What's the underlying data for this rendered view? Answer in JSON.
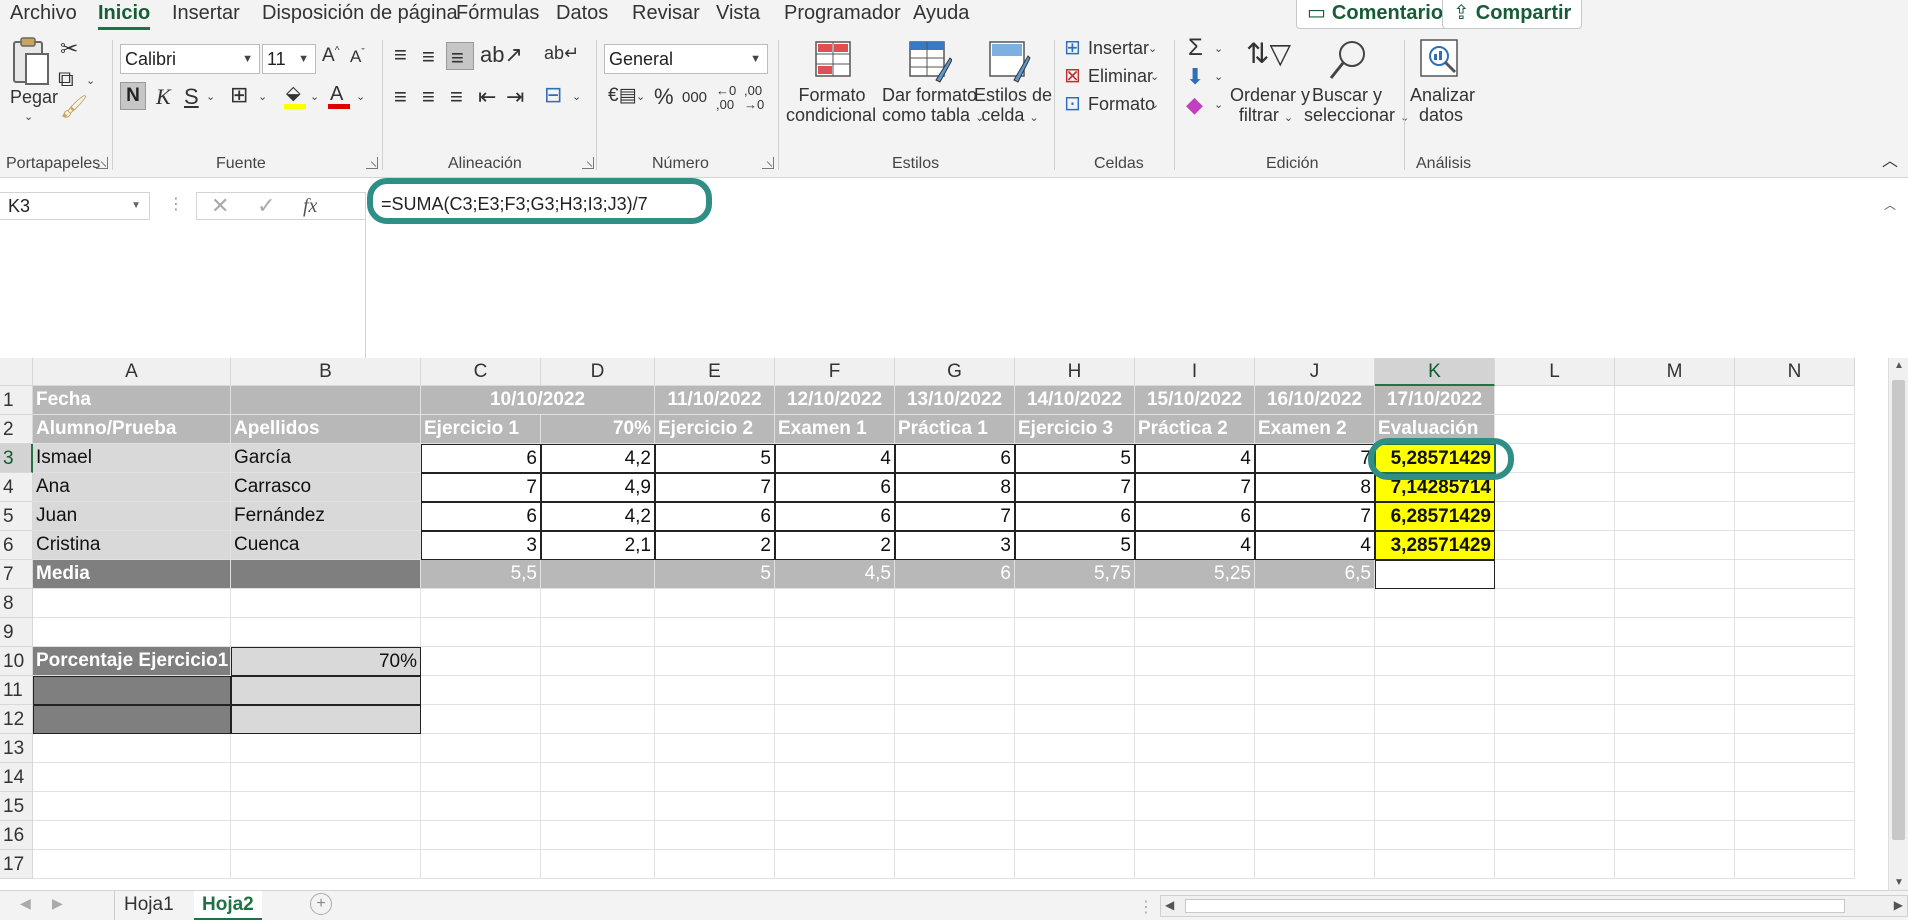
{
  "menu": {
    "items": [
      "Archivo",
      "Inicio",
      "Insertar",
      "Disposición de página",
      "Fórmulas",
      "Datos",
      "Revisar",
      "Vista",
      "Programador",
      "Ayuda"
    ],
    "active": "Inicio",
    "comments_label": "Comentarios",
    "share_label": "Compartir"
  },
  "ribbon": {
    "clipboard": {
      "paste_label": "Pegar",
      "group_label": "Portapapeles"
    },
    "font": {
      "font_name": "Calibri",
      "font_size": "11",
      "bold": "N",
      "italic": "K",
      "underline": "S",
      "group_label": "Fuente",
      "fill_color": "#ffff00",
      "font_color": "#e00000"
    },
    "alignment": {
      "group_label": "Alineación"
    },
    "number": {
      "format": "General",
      "percent": "%",
      "thousands": "000",
      "dec_inc": ",00",
      "dec_dec": ",00",
      "group_label": "Número"
    },
    "styles": {
      "conditional_l1": "Formato",
      "conditional_l2": "condicional",
      "table_l1": "Dar formato",
      "table_l2": "como tabla",
      "cell_styles_l1": "Estilos de",
      "cell_styles_l2": "celda",
      "group_label": "Estilos"
    },
    "cells": {
      "insert": "Insertar",
      "delete": "Eliminar",
      "format": "Formato",
      "group_label": "Celdas"
    },
    "editing": {
      "sort_l1": "Ordenar y",
      "sort_l2": "filtrar",
      "find_l1": "Buscar y",
      "find_l2": "seleccionar",
      "group_label": "Edición"
    },
    "analysis": {
      "analyze_l1": "Analizar",
      "analyze_l2": "datos",
      "group_label": "Análisis"
    }
  },
  "formula_bar": {
    "name_box": "K3",
    "fx": "fx",
    "formula": "=SUMA(C3;E3;F3;G3;H3;I3;J3)/7"
  },
  "grid": {
    "columns": [
      "A",
      "B",
      "C",
      "D",
      "E",
      "F",
      "G",
      "H",
      "I",
      "J",
      "K",
      "L",
      "M",
      "N"
    ],
    "selected_column": "K",
    "rows": [
      "1",
      "2",
      "3",
      "4",
      "5",
      "6",
      "7",
      "8",
      "9",
      "10",
      "11",
      "12",
      "13",
      "14",
      "15",
      "16",
      "17"
    ],
    "selected_row": "3",
    "header_row1": {
      "a": "Fecha",
      "cd": "10/10/2022",
      "e": "11/10/2022",
      "f": "12/10/2022",
      "g": "13/10/2022",
      "h": "14/10/2022",
      "i": "15/10/2022",
      "j": "16/10/2022",
      "k": "17/10/2022"
    },
    "header_row2": {
      "a": "Alumno/Prueba",
      "b": "Apellidos",
      "c": "Ejercicio 1",
      "d": "70%",
      "e": "Ejercicio 2",
      "f": "Examen 1",
      "g": "Práctica 1",
      "h": "Ejercicio 3",
      "i": "Práctica 2",
      "j": "Examen 2",
      "k": "Evaluación"
    },
    "students": [
      {
        "name": "Ismael",
        "surname": "García",
        "c": "6",
        "d": "4,2",
        "e": "5",
        "f": "4",
        "g": "6",
        "h": "5",
        "i": "4",
        "j": "7",
        "k": "5,28571429"
      },
      {
        "name": "Ana",
        "surname": "Carrasco",
        "c": "7",
        "d": "4,9",
        "e": "7",
        "f": "6",
        "g": "8",
        "h": "7",
        "i": "7",
        "j": "8",
        "k": "7,14285714"
      },
      {
        "name": "Juan",
        "surname": "Fernández",
        "c": "6",
        "d": "4,2",
        "e": "6",
        "f": "6",
        "g": "7",
        "h": "6",
        "i": "6",
        "j": "7",
        "k": "6,28571429"
      },
      {
        "name": "Cristina",
        "surname": "Cuenca",
        "c": "3",
        "d": "2,1",
        "e": "2",
        "f": "2",
        "g": "3",
        "h": "5",
        "i": "4",
        "j": "4",
        "k": "3,28571429"
      }
    ],
    "media_row": {
      "label": "Media",
      "c": "5,5",
      "e": "5",
      "f": "4,5",
      "g": "6",
      "h": "5,75",
      "i": "5,25",
      "j": "6,5"
    },
    "percent_row": {
      "label": "Porcentaje Ejercicio1",
      "value": "70%"
    }
  },
  "sheets": {
    "tabs": [
      "Hoja1",
      "Hoja2"
    ],
    "active": "Hoja2"
  },
  "colors": {
    "highlight_ring": "#2f8f86",
    "accent": "#1f7246",
    "yellow": "#ffff00"
  }
}
